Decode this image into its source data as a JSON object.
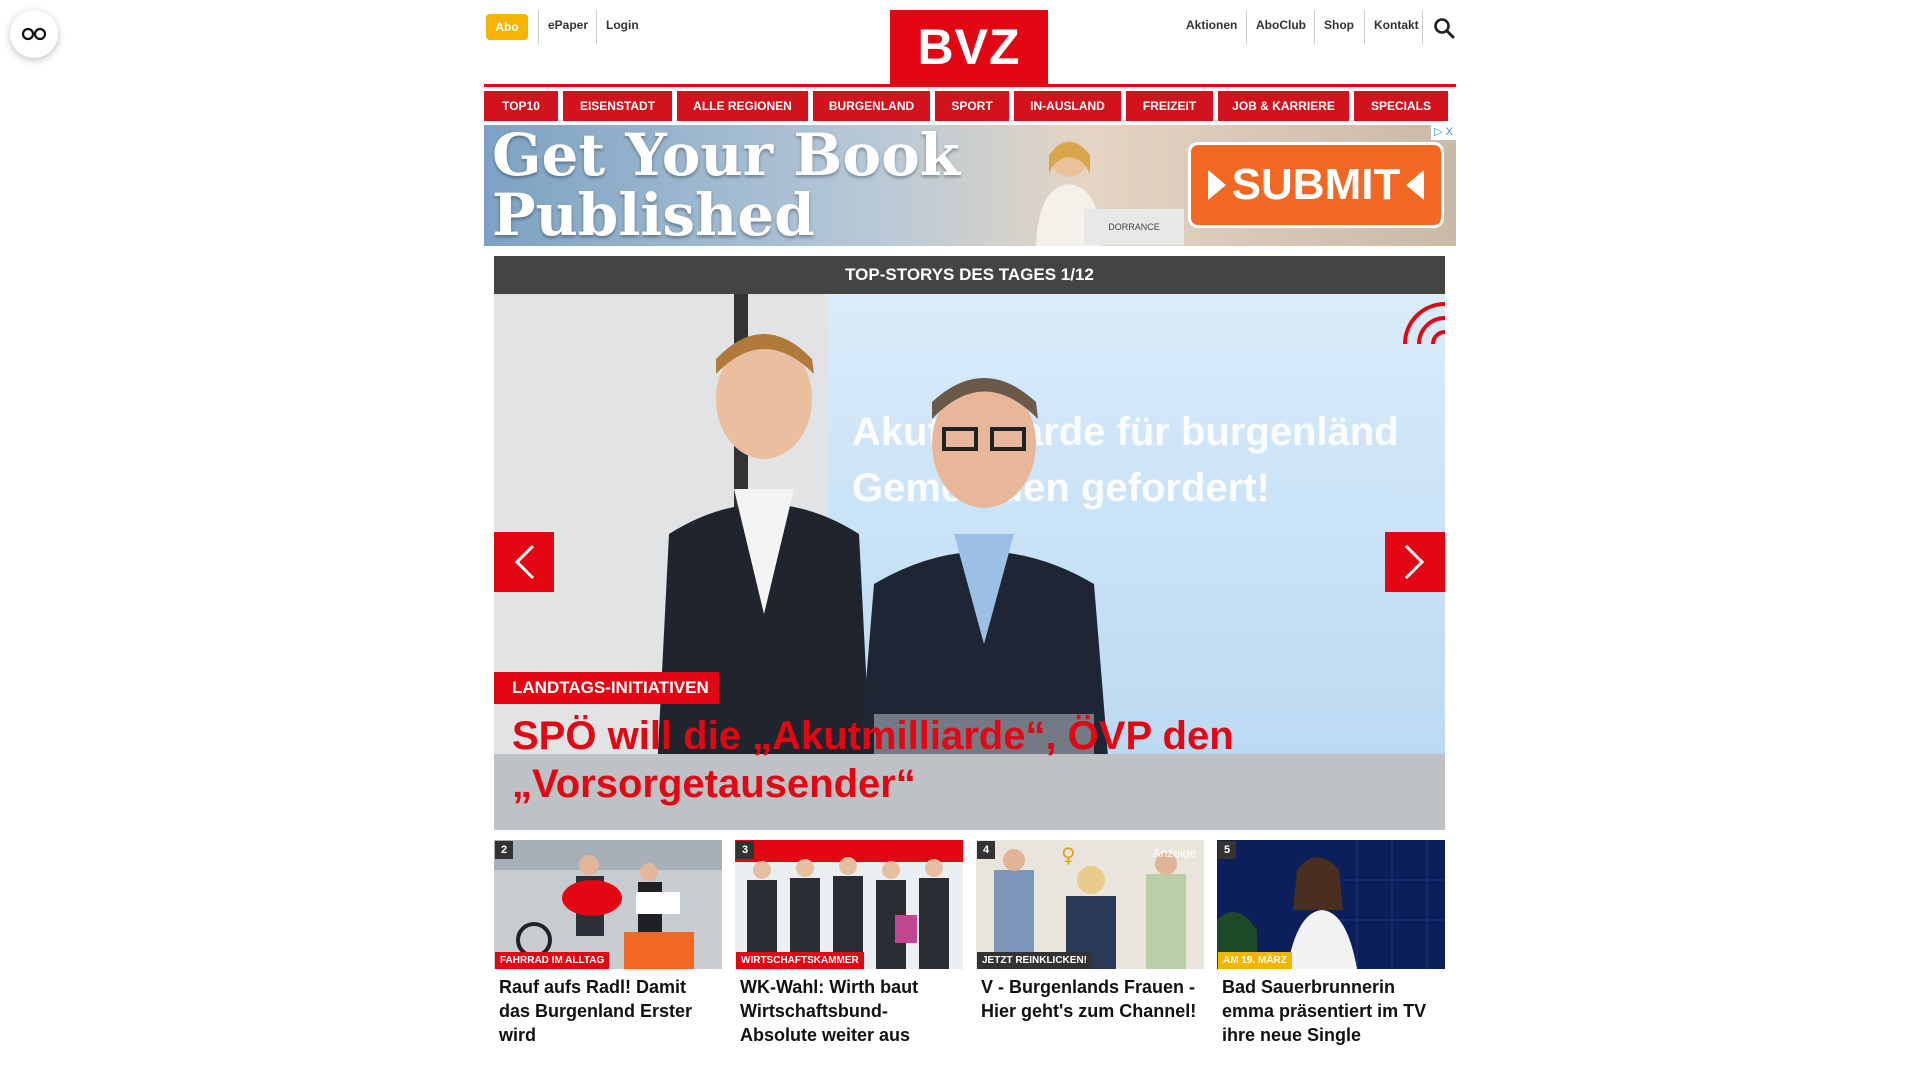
{
  "header": {
    "abo_label": "Abo",
    "left_links": [
      "ePaper",
      "Login"
    ],
    "logo": "BVZ",
    "right_links": [
      "Aktionen",
      "AboClub",
      "Shop",
      "Kontakt"
    ]
  },
  "nav": {
    "items": [
      "TOP10",
      "EISENSTADT",
      "ALLE REGIONEN",
      "BURGENLAND",
      "SPORT",
      "IN-AUSLAND",
      "FREIZEIT",
      "JOB & KARRIERE",
      "SPECIALS"
    ]
  },
  "ad": {
    "headline_line1": "Get Your Book",
    "headline_line2": "Published",
    "cta": "SUBMIT",
    "brand": "DORRANCE",
    "choices": "▷ X"
  },
  "top_stories": {
    "header": "TOP-STORYS DES TAGES 1/12",
    "hero": {
      "kicker": "LANDTAGS-INITIATIVEN",
      "title": "SPÖ will die „Akutmilliarde“, ÖVP den „Vorsorgetausender“",
      "screen_line1": "Akutmilliarde für burgenländ",
      "screen_line2": "Gemeinden gefordert!"
    }
  },
  "cards": [
    {
      "num": "2",
      "label": "FAHRRAD IM ALLTAG",
      "label_color": "#e30613",
      "title": "Rauf aufs Radl! Damit das Burgenland Erster wird"
    },
    {
      "num": "3",
      "label": "WIRTSCHAFTSKAMMER",
      "label_color": "#e30613",
      "title": "WK-Wahl: Wirth baut Wirtschaftsbund-Absolute weiter aus"
    },
    {
      "num": "4",
      "label": "JETZT REINKLICKEN!",
      "label_color": "#333333",
      "ad_tag": "Anzeige",
      "title": "V - Burgenlands Frauen - Hier geht's zum Channel!"
    },
    {
      "num": "5",
      "label": "AM 19. MÄRZ",
      "label_color": "#f4b400",
      "title": "Bad Sauerbrunnerin emma präsentiert im TV ihre neue Single"
    }
  ],
  "colors": {
    "brand_red": "#e30613",
    "abo_yellow": "#f4b400",
    "dark_bar": "#444444"
  }
}
